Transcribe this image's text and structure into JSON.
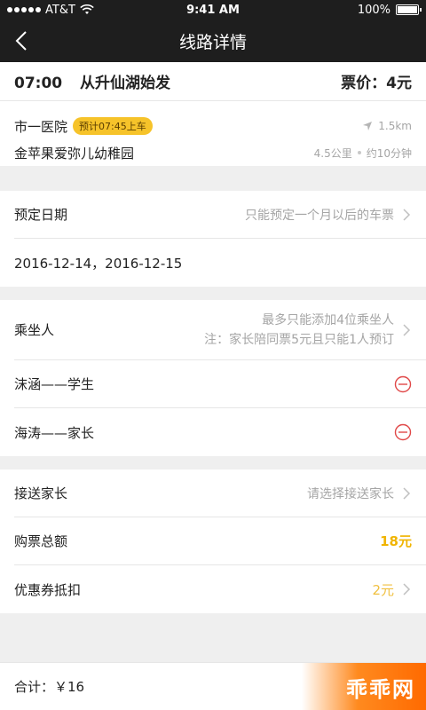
{
  "status_bar": {
    "carrier": "AT&T",
    "time": "9:41 AM",
    "battery": "100%"
  },
  "nav": {
    "title": "线路详情"
  },
  "trip": {
    "depart_time": "07:00",
    "depart_from": "从升仙湖始发",
    "price": "票价：4元",
    "boarding_stop": "市一医院",
    "boarding_badge": "预计07:45上车",
    "boarding_distance": "1.5km",
    "destination": "金苹果爱弥儿幼稚园",
    "destination_distance": "4.5公里",
    "destination_duration": "约10分钟"
  },
  "booking": {
    "date_label": "预定日期",
    "date_hint": "只能预定一个月以后的车票",
    "date_values": "2016-12-14，2016-12-15"
  },
  "passengers": {
    "label": "乘坐人",
    "hint_line1": "最多只能添加4位乘坐人",
    "hint_line2": "注：家长陪同票5元且只能1人预订",
    "list": [
      {
        "name": "沫涵——学生"
      },
      {
        "name": "海涛——家长"
      }
    ]
  },
  "summary": {
    "guardian_label": "接送家长",
    "guardian_hint": "请选择接送家长",
    "total_label": "购票总额",
    "total_value": "18元",
    "coupon_label": "优惠券抵扣",
    "coupon_value": "2元"
  },
  "footer": {
    "total": "合计：￥16",
    "brand": "乖乖网"
  },
  "colors": {
    "accent": "#f6c32a",
    "dark_bar": "#1e1e1e",
    "remove_red": "#e04848",
    "brand_orange": "#ff6a00"
  }
}
